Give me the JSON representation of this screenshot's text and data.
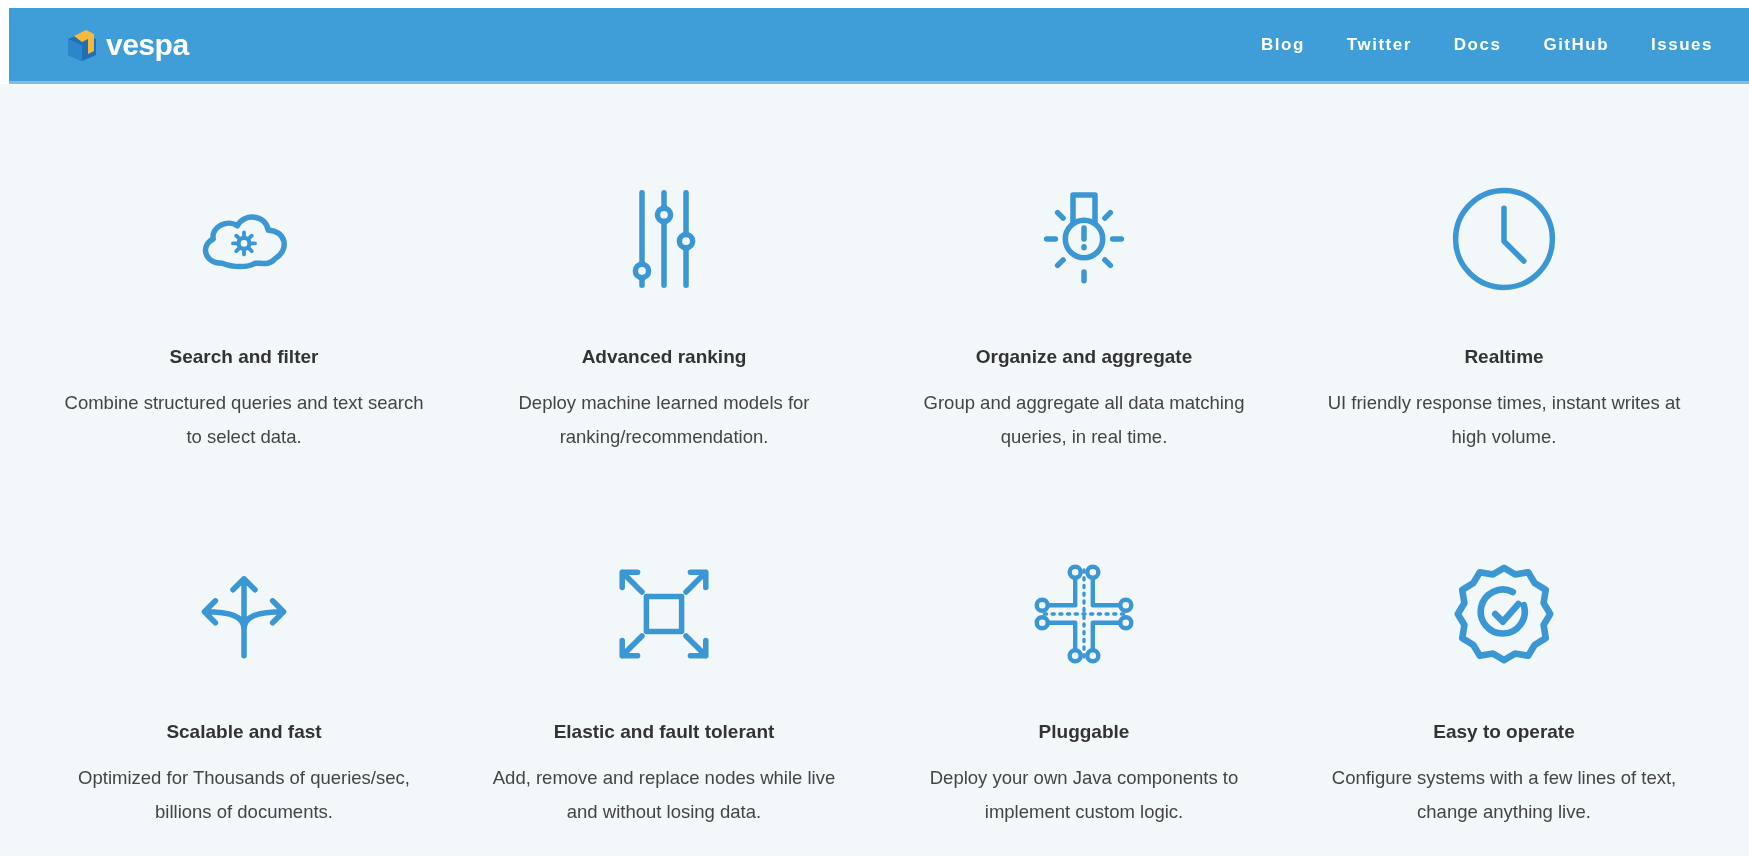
{
  "header": {
    "logo_text": "vespa",
    "nav": [
      "Blog",
      "Twitter",
      "Docs",
      "GitHub",
      "Issues"
    ]
  },
  "features": [
    {
      "kind": "cloud",
      "title": "Search and filter",
      "description": "Combine structured queries and text search to select data."
    },
    {
      "kind": "sliders",
      "title": "Advanced ranking",
      "description": "Deploy machine learned models for ranking/recommendation."
    },
    {
      "kind": "bulb",
      "title": "Organize and aggregate",
      "description": "Group and aggregate all data matching queries, in real time."
    },
    {
      "kind": "clock",
      "title": "Realtime",
      "description": "UI friendly response times, instant writes at high volume."
    },
    {
      "kind": "split",
      "title": "Scalable and fast",
      "description": "Optimized for Thousands of queries/sec, billions of documents."
    },
    {
      "kind": "expand",
      "title": "Elastic and fault tolerant",
      "description": "Add, remove and replace nodes while live and without losing data."
    },
    {
      "kind": "circuit",
      "title": "Pluggable",
      "description": "Deploy your own Java components to implement custom logic."
    },
    {
      "kind": "badge",
      "title": "Easy to operate",
      "description": "Configure systems with a few lines of text, change anything live."
    }
  ]
}
